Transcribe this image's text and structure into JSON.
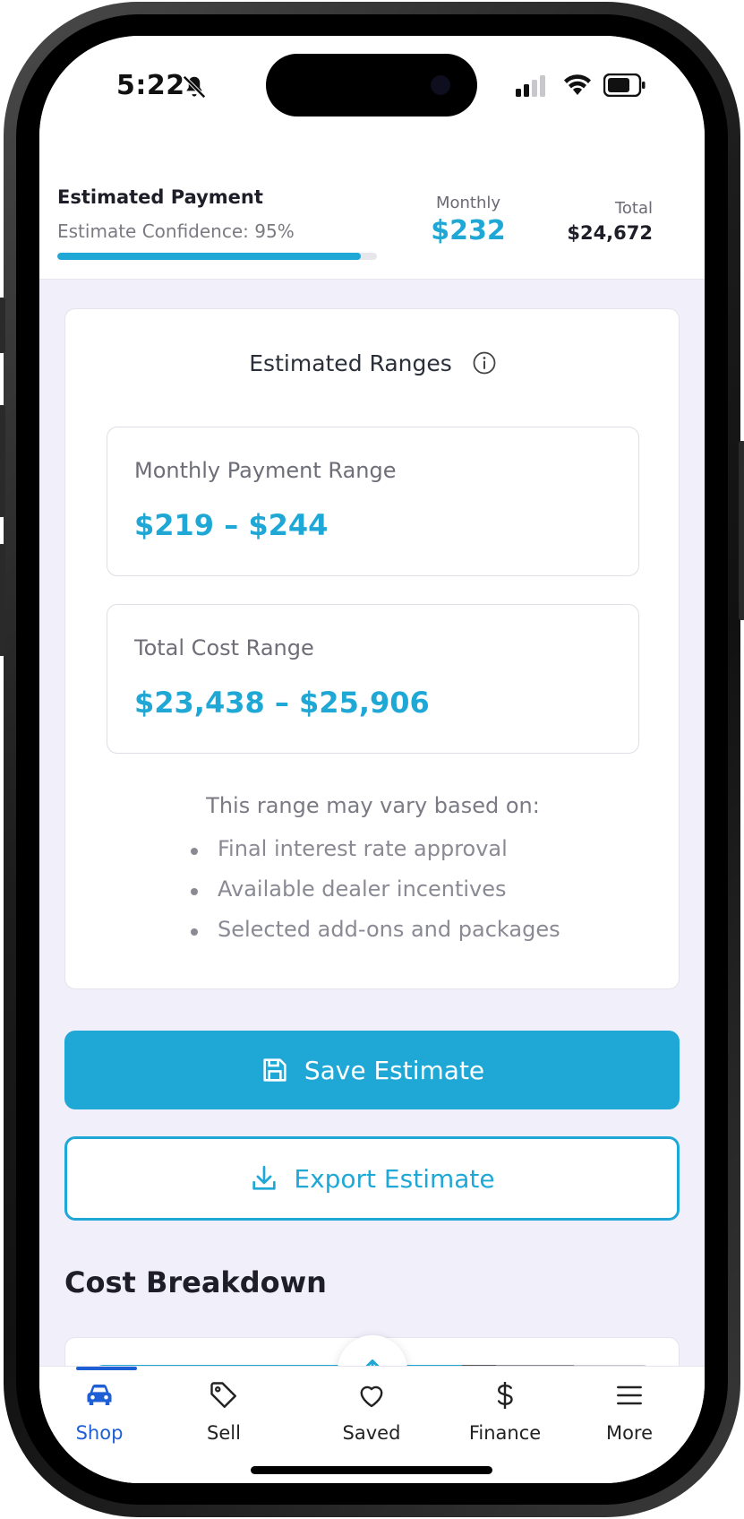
{
  "status_bar": {
    "time": "5:22"
  },
  "header": {
    "title": "Estimated Payment",
    "confidence_text": "Estimate Confidence: 95%",
    "confidence_fraction": 0.95,
    "monthly_label": "Monthly",
    "monthly_value": "$232",
    "total_label": "Total",
    "total_value": "$24,672"
  },
  "ranges_card": {
    "title": "Estimated Ranges",
    "monthly_range": {
      "label": "Monthly Payment Range",
      "value": "$219 – $244"
    },
    "total_range": {
      "label": "Total Cost Range",
      "value": "$23,438 – $25,906"
    },
    "vary_intro": "This range may vary based on:",
    "vary_items": [
      "Final interest rate approval",
      "Available dealer incentives",
      "Selected add-ons and packages"
    ]
  },
  "actions": {
    "save_label": "Save Estimate",
    "export_label": "Export Estimate"
  },
  "breakdown": {
    "title": "Cost Breakdown",
    "segments": [
      {
        "fraction": 0.66,
        "color": "#1fa8d6"
      },
      {
        "fraction": 0.06,
        "color": "#555555"
      },
      {
        "fraction": 0.14,
        "color": "#888888"
      },
      {
        "fraction": 0.14,
        "color": "#c8c8c8"
      }
    ]
  },
  "bottom_nav": {
    "items": [
      {
        "label": "Shop",
        "icon": "car-icon",
        "active": true
      },
      {
        "label": "Sell",
        "icon": "tag-icon",
        "active": false
      },
      {
        "label": "Saved",
        "icon": "heart-icon",
        "active": false
      },
      {
        "label": "Finance",
        "icon": "dollar-icon",
        "active": false
      },
      {
        "label": "More",
        "icon": "menu-icon",
        "active": false
      }
    ]
  },
  "colors": {
    "accent": "#1fa8d6",
    "nav_active": "#1f5fd6",
    "background": "#f1f0fa"
  }
}
